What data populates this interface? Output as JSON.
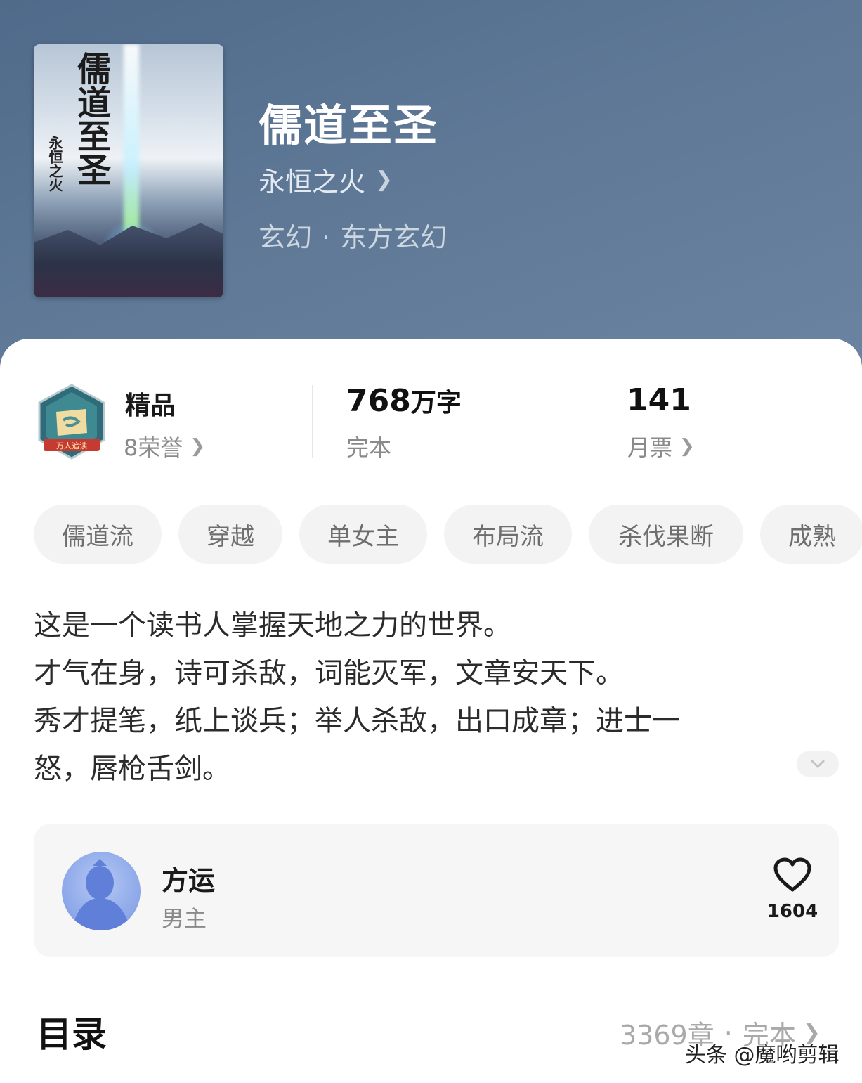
{
  "book": {
    "title": "儒道至圣",
    "author": "永恒之火",
    "category": "玄幻",
    "subcategory": "东方玄幻",
    "cover": {
      "title_text": "儒道至圣",
      "author_text": "永恒之火"
    }
  },
  "stats": {
    "level_label": "精品",
    "honors_label": "8荣誉",
    "word_count": "768",
    "word_unit": "万字",
    "status": "完本",
    "monthly_votes": "141",
    "monthly_votes_label": "月票",
    "badge_text": "万人追读"
  },
  "tags": [
    "儒道流",
    "穿越",
    "单女主",
    "布局流",
    "杀伐果断",
    "成熟"
  ],
  "intro": [
    "这是一个读书人掌握天地之力的世界。",
    "才气在身，诗可杀敌，词能灭军，文章安天下。",
    "秀才提笔，纸上谈兵；举人杀敌，出口成章；进士一",
    "怒，唇枪舌剑。"
  ],
  "character": {
    "name": "方运",
    "role": "男主",
    "likes": "1604"
  },
  "toc": {
    "title": "目录",
    "chapters": "3369章",
    "status": "完本"
  },
  "watermark": "头条 @魔哟剪辑",
  "colors": {
    "hero_bg": "#56708f",
    "card_bg": "#ffffff",
    "tag_bg": "#f3f3f3",
    "muted_text": "#8a8a8a"
  },
  "icons": {
    "chevron": "chevron-right-icon",
    "heart": "heart-outline-icon",
    "expand": "chevron-down-icon"
  }
}
